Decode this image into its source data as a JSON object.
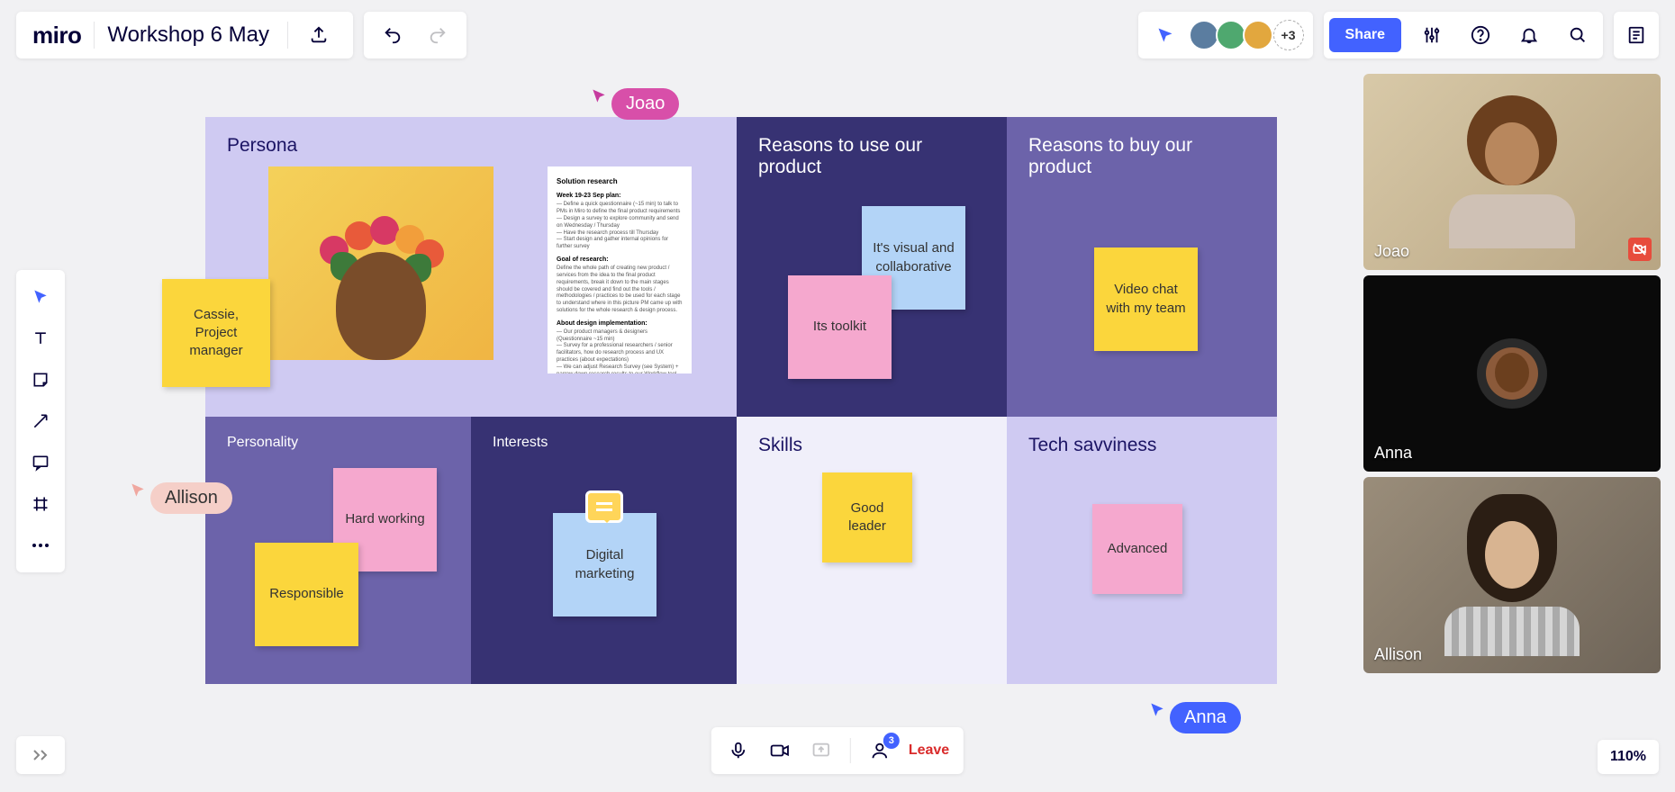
{
  "brand": "miro",
  "board_title": "Workshop 6 May",
  "share_label": "Share",
  "extra_users": "+3",
  "zoom": "110%",
  "call": {
    "people_count": "3",
    "leave_label": "Leave"
  },
  "cursors": {
    "joao": "Joao",
    "anna": "Anna",
    "allison": "Allison"
  },
  "frames": {
    "persona": "Persona",
    "reasons_use": "Reasons to use our product",
    "reasons_buy": "Reasons to buy our product",
    "personality": "Personality",
    "interests": "Interests",
    "skills": "Skills",
    "tech": "Tech savviness"
  },
  "notes": {
    "cassie": "Cassie, Project manager",
    "visual": "It's visual and collaborative",
    "toolkit": "Its toolkit",
    "video_chat": "Video chat with my team",
    "hard_working": "Hard working",
    "responsible": "Responsible",
    "digital_marketing": "Digital marketing",
    "good_leader": "Good leader",
    "advanced": "Advanced"
  },
  "doc": {
    "title": "Solution research",
    "week": "Week 19-23 Sep plan:",
    "goal_h": "Goal of research:",
    "impl_h": "About design implementation:"
  },
  "videos": {
    "p1": "Joao",
    "p2": "Anna",
    "p3": "Allison"
  }
}
